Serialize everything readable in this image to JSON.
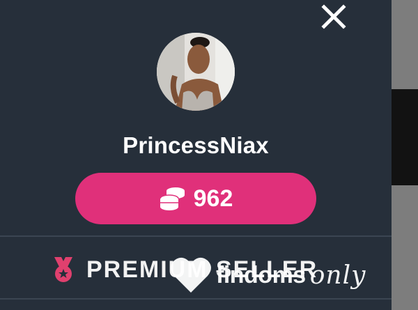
{
  "profile": {
    "username": "PrincessNiax",
    "coin_balance": "962",
    "badge_label": "PREMIUM SELLER"
  },
  "watermark": {
    "brand_word": "findoms",
    "brand_script": "only"
  },
  "icons": {
    "close": "close-icon",
    "coins": "coins-stack-icon",
    "badge": "medal-ribbon-icon",
    "watermark_heart": "heart-icon"
  },
  "colors": {
    "panel_background": "#262f3a",
    "balance_button": "#e0307a",
    "badge_icon": "#e0406e",
    "text": "#ffffff"
  }
}
